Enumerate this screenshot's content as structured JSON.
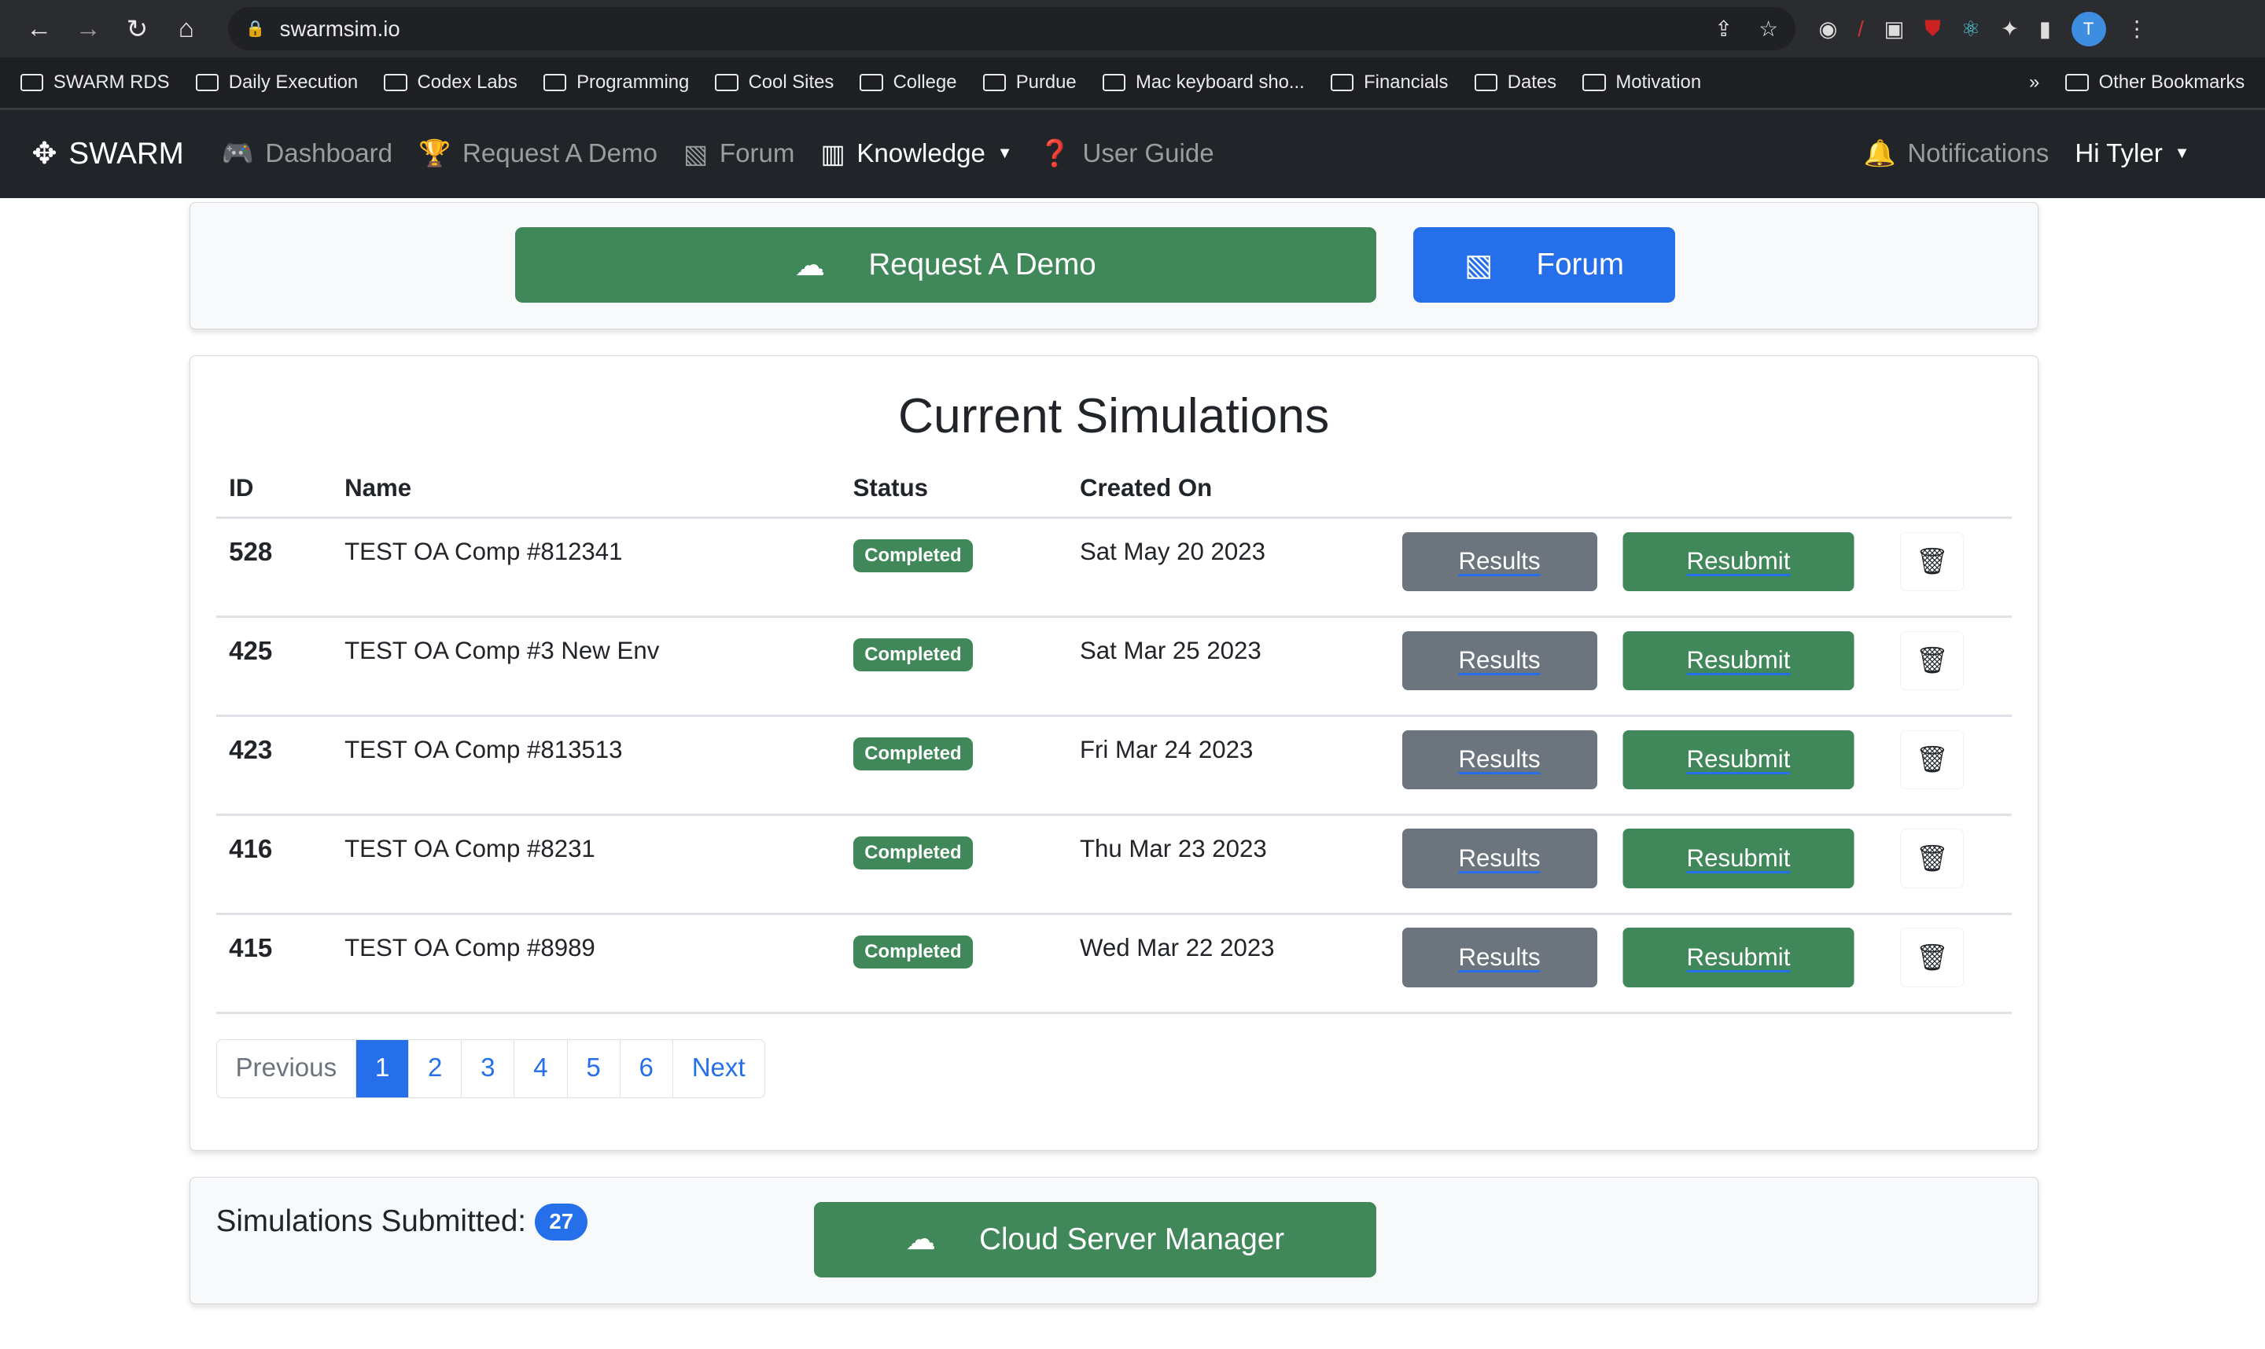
{
  "browser": {
    "url": "swarmsim.io",
    "bookmarks": [
      "SWARM RDS",
      "Daily Execution",
      "Codex Labs",
      "Programming",
      "Cool Sites",
      "College",
      "Purdue",
      "Mac keyboard sho...",
      "Financials",
      "Dates",
      "Motivation"
    ],
    "other_bookmarks": "Other Bookmarks",
    "avatar_letter": "T",
    "more": "»"
  },
  "navbar": {
    "brand": "SWARM",
    "items": [
      "Dashboard",
      "Request A Demo",
      "Forum",
      "Knowledge",
      "User Guide"
    ],
    "notifications": "Notifications",
    "user": "Hi Tyler"
  },
  "top": {
    "request_demo": "Request A Demo",
    "forum": "Forum"
  },
  "sims": {
    "title": "Current Simulations",
    "headers": [
      "ID",
      "Name",
      "Status",
      "Created On"
    ],
    "rows": [
      {
        "id": "528",
        "name": "TEST OA Comp #812341",
        "status": "Completed",
        "created": "Sat May 20 2023"
      },
      {
        "id": "425",
        "name": "TEST OA Comp #3 New Env",
        "status": "Completed",
        "created": "Sat Mar 25 2023"
      },
      {
        "id": "423",
        "name": "TEST OA Comp #813513",
        "status": "Completed",
        "created": "Fri Mar 24 2023"
      },
      {
        "id": "416",
        "name": "TEST OA Comp #8231",
        "status": "Completed",
        "created": "Thu Mar 23 2023"
      },
      {
        "id": "415",
        "name": "TEST OA Comp #8989",
        "status": "Completed",
        "created": "Wed Mar 22 2023"
      }
    ],
    "results_label": "Results",
    "resubmit_label": "Resubmit",
    "pagination": {
      "prev": "Previous",
      "pages": [
        "1",
        "2",
        "3",
        "4",
        "5",
        "6"
      ],
      "current": "1",
      "next": "Next"
    }
  },
  "bottom": {
    "submitted_label": "Simulations Submitted:",
    "submitted_count": "27",
    "cloud": "Cloud Server Manager"
  },
  "colors": {
    "green": "#40875a",
    "blue": "#2570ea",
    "gray": "#6c757d",
    "navbar": "#212529"
  }
}
